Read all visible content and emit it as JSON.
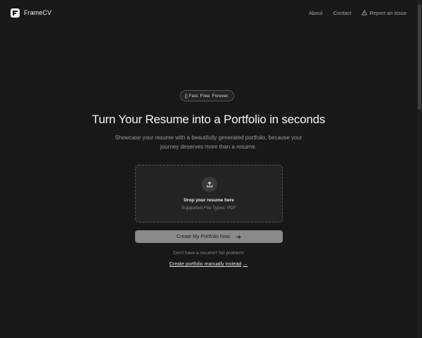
{
  "header": {
    "brand_name": "FrameCV",
    "nav": {
      "about": "About",
      "contact": "Contact",
      "report_issue": "Report an issue"
    }
  },
  "hero": {
    "badge": "[] Fast. Free. Forever.",
    "title": "Turn Your Resume into a Portfolio in seconds",
    "subtitle": "Showcase your resume with a beautifully generated portfolio, because your journey deserves more than a resume."
  },
  "dropzone": {
    "title": "Drop your resume here",
    "supported_types": "Supported File Types: PDF",
    "icon": "upload-icon"
  },
  "actions": {
    "create_button": "Create My Portfolio Now",
    "no_resume_text": "Don't have a resume? No problem!",
    "manual_link": "Create portfolio manually instead",
    "manual_link_arrow": "→"
  },
  "colors": {
    "background": "#18181a",
    "surface": "#232326",
    "button": "#8a8a8e",
    "text_primary": "#f4f4f6",
    "text_muted": "#9a9aa0"
  }
}
